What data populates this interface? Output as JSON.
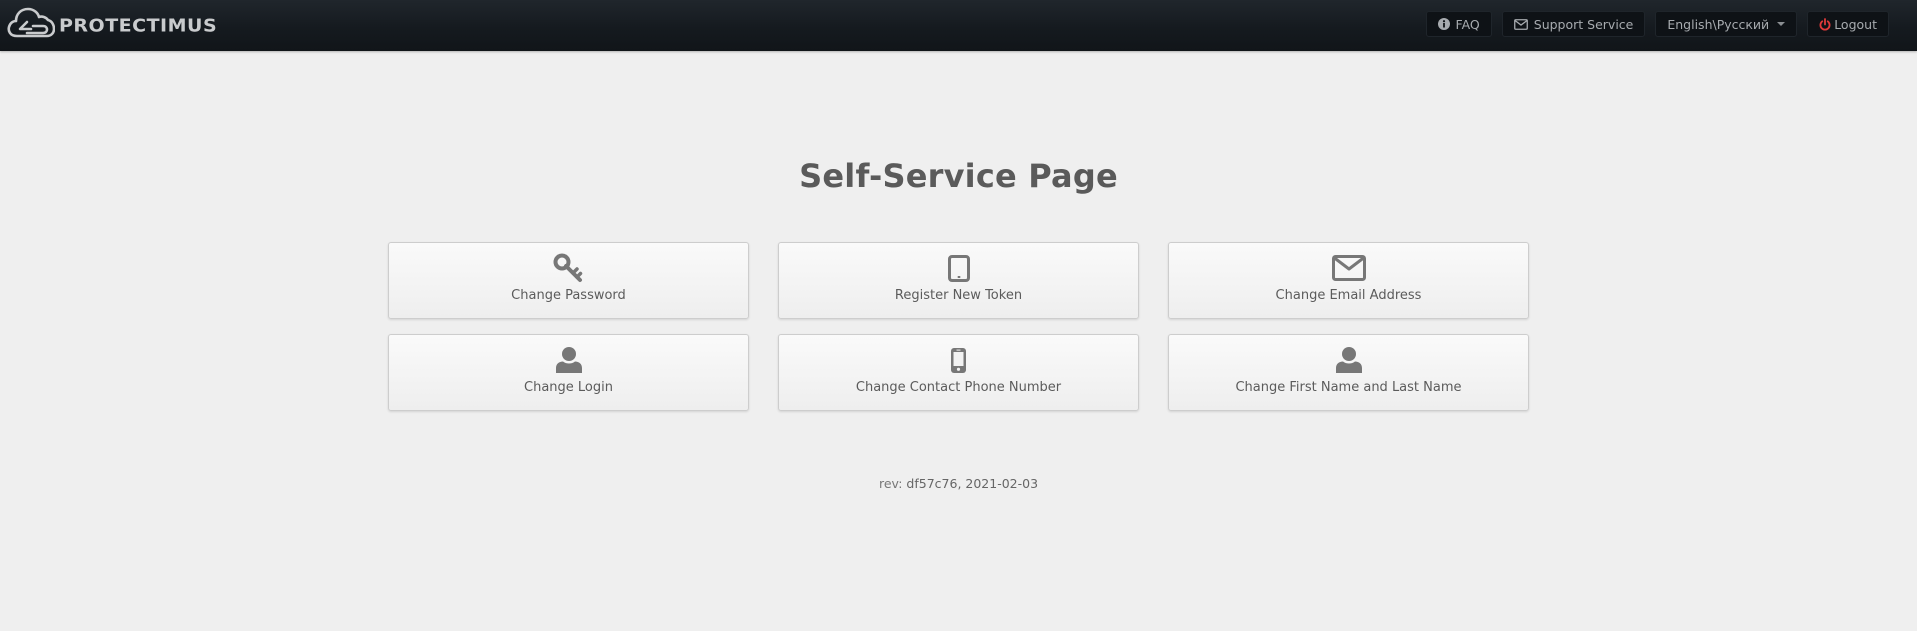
{
  "header": {
    "brand": "protectimus",
    "nav": {
      "faq": {
        "label": "FAQ",
        "icon": "info-circle-icon"
      },
      "support": {
        "label": "Support Service",
        "icon": "envelope-icon"
      },
      "language": {
        "label": "English\\Русский",
        "icon": "caret-down-icon"
      },
      "logout": {
        "label": "Logout",
        "icon": "power-icon",
        "icon_color": "#e03a3a"
      }
    }
  },
  "main": {
    "title": "Self-Service Page",
    "tiles": [
      {
        "label": "Change Password",
        "icon": "key-icon"
      },
      {
        "label": "Register New Token",
        "icon": "tablet-icon"
      },
      {
        "label": "Change Email Address",
        "icon": "envelope-icon"
      },
      {
        "label": "Change Login",
        "icon": "user-icon"
      },
      {
        "label": "Change Contact Phone Number",
        "icon": "mobile-phone-icon"
      },
      {
        "label": "Change First Name and Last Name",
        "icon": "user-icon"
      }
    ]
  },
  "footer": {
    "rev_label": "rev:",
    "rev_value": "df57c76, 2021-02-03"
  },
  "colors": {
    "navbar": "#151a1f",
    "background": "#efefef",
    "icon_gray": "#777777",
    "logout_red": "#e03a3a"
  }
}
